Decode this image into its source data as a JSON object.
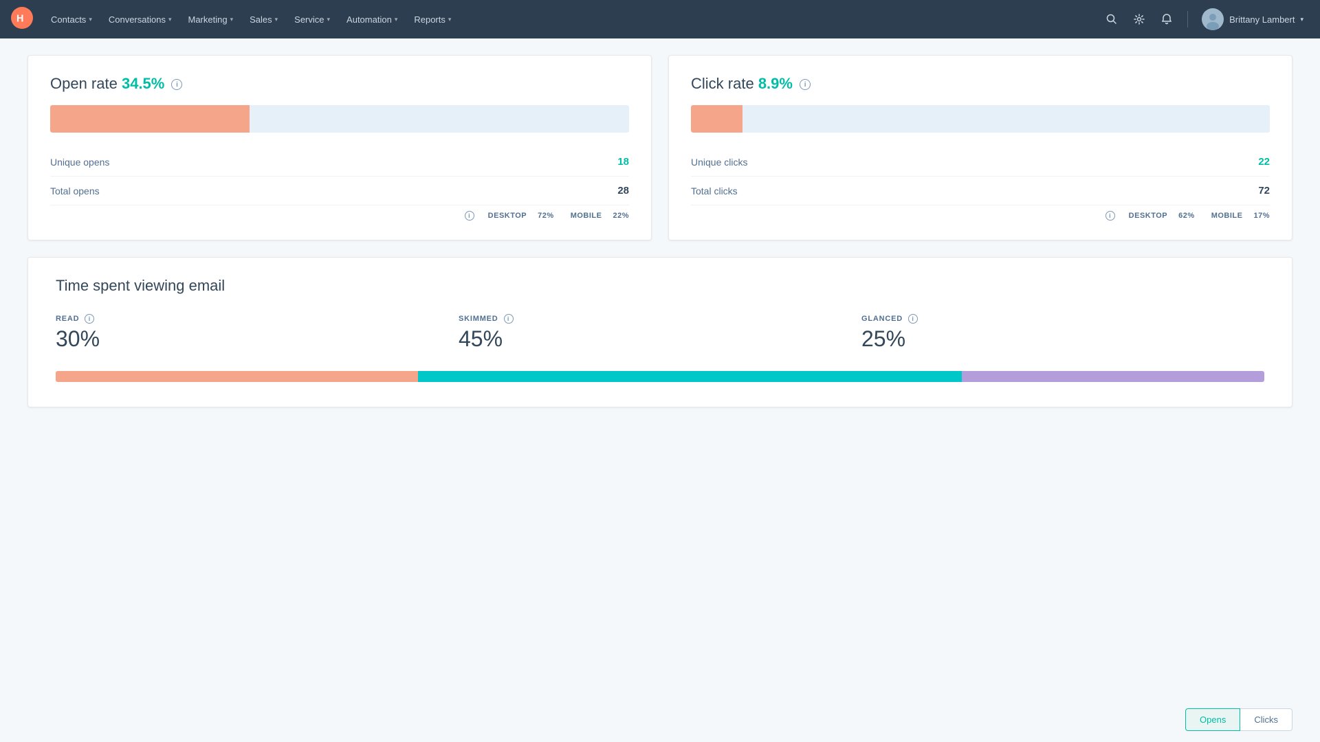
{
  "nav": {
    "brand": "HubSpot",
    "items": [
      {
        "label": "Contacts",
        "id": "contacts"
      },
      {
        "label": "Conversations",
        "id": "conversations"
      },
      {
        "label": "Marketing",
        "id": "marketing"
      },
      {
        "label": "Sales",
        "id": "sales"
      },
      {
        "label": "Service",
        "id": "service"
      },
      {
        "label": "Automation",
        "id": "automation"
      },
      {
        "label": "Reports",
        "id": "reports"
      }
    ],
    "user": {
      "name": "Brittany Lambert"
    }
  },
  "open_rate": {
    "title": "Open rate",
    "value": "34.5%",
    "bar_pct": 34.5,
    "unique_opens_label": "Unique opens",
    "unique_opens_value": "18",
    "total_opens_label": "Total opens",
    "total_opens_value": "28",
    "desktop_pct": "72%",
    "mobile_pct": "22%",
    "desktop_label": "DESKTOP",
    "mobile_label": "MOBILE"
  },
  "click_rate": {
    "title": "Click rate",
    "value": "8.9%",
    "bar_pct": 8.9,
    "unique_clicks_label": "Unique clicks",
    "unique_clicks_value": "22",
    "total_clicks_label": "Total clicks",
    "total_clicks_value": "72",
    "desktop_pct": "62%",
    "mobile_pct": "17%",
    "desktop_label": "DESKTOP",
    "mobile_label": "MOBILE"
  },
  "time_spent": {
    "title": "Time spent viewing email",
    "read": {
      "label": "READ",
      "value": "30%",
      "pct": 30
    },
    "skimmed": {
      "label": "SKIMMED",
      "value": "45%",
      "pct": 45
    },
    "glanced": {
      "label": "GLANCED",
      "value": "25%",
      "pct": 25
    }
  },
  "bottom_tabs": {
    "opens": "Opens",
    "clicks": "Clicks"
  },
  "colors": {
    "salmon": "#f5a58a",
    "teal": "#00bda5",
    "teal_bar": "#00c8c8",
    "lavender": "#b39ddb",
    "bar_bg": "#e5f0f8"
  }
}
